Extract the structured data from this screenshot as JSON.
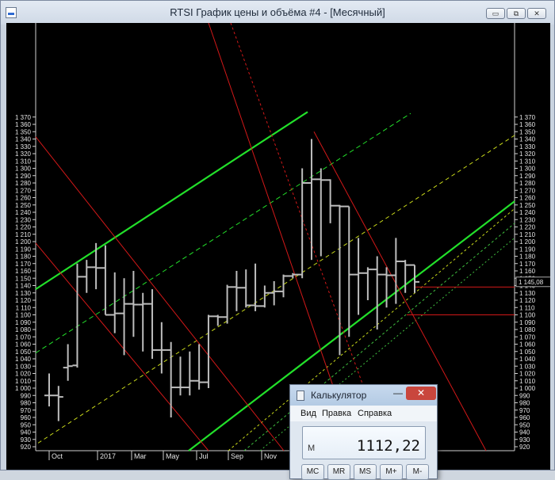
{
  "window": {
    "title": "RTSI График цены и объёма #4 - [Месячный]",
    "buttons": [
      "▭",
      "⧉",
      "✕"
    ]
  },
  "chart_data": {
    "type": "ohlc",
    "ylim": [
      917,
      1377
    ],
    "ticks": [
      920,
      930,
      940,
      950,
      960,
      970,
      980,
      990,
      1000,
      1010,
      1020,
      1030,
      1040,
      1050,
      1060,
      1070,
      1080,
      1090,
      1100,
      1110,
      1120,
      1130,
      1140,
      1150,
      1160,
      1170,
      1180,
      1190,
      1200,
      1210,
      1220,
      1230,
      1240,
      1250,
      1260,
      1270,
      1280,
      1290,
      1300,
      1310,
      1320,
      1330,
      1340,
      1350,
      1360,
      1370
    ],
    "tick_labels": [
      "920",
      "930",
      "940",
      "950",
      "960",
      "970",
      "980",
      "990",
      "1 000",
      "1 010",
      "1 020",
      "1 030",
      "1 040",
      "1 050",
      "1 060",
      "1 070",
      "1 080",
      "1 090",
      "1 100",
      "1 110",
      "1 120",
      "1 130",
      "1 140",
      "1 150",
      "1 160",
      "1 170",
      "1 180",
      "1 190",
      "1 200",
      "1 210",
      "1 220",
      "1 230",
      "1 240",
      "1 250",
      "1 260",
      "1 270",
      "1 280",
      "1 290",
      "1 300",
      "1 310",
      "1 320",
      "1 330",
      "1 340",
      "1 350",
      "1 360",
      "1 370"
    ],
    "x_labels": [
      "Oct",
      "2017",
      "Mar",
      "May",
      "Jul",
      "Sep",
      "Nov"
    ],
    "last_price_label": "1 145,08",
    "last_price": 1145.08,
    "bars": [
      {
        "o": 990,
        "h": 1020,
        "l": 975,
        "c": 990
      },
      {
        "o": 990,
        "h": 1003,
        "l": 955,
        "c": 988
      },
      {
        "o": 1028,
        "h": 1060,
        "l": 1010,
        "c": 1030
      },
      {
        "o": 1031,
        "h": 1170,
        "l": 1028,
        "c": 1152
      },
      {
        "o": 1152,
        "h": 1175,
        "l": 1130,
        "c": 1165
      },
      {
        "o": 1165,
        "h": 1198,
        "l": 1135,
        "c": 1164
      },
      {
        "o": 1164,
        "h": 1195,
        "l": 1100,
        "c": 1100
      },
      {
        "o": 1100,
        "h": 1158,
        "l": 1075,
        "c": 1102
      },
      {
        "o": 1102,
        "h": 1150,
        "l": 1045,
        "c": 1115
      },
      {
        "o": 1115,
        "h": 1160,
        "l": 1070,
        "c": 1114
      },
      {
        "o": 1114,
        "h": 1130,
        "l": 1050,
        "c": 1115
      },
      {
        "o": 1115,
        "h": 1135,
        "l": 1040,
        "c": 1052
      },
      {
        "o": 1052,
        "h": 1090,
        "l": 1020,
        "c": 1052
      },
      {
        "o": 1052,
        "h": 1063,
        "l": 960,
        "c": 1001
      },
      {
        "o": 1001,
        "h": 1043,
        "l": 990,
        "c": 1001
      },
      {
        "o": 1001,
        "h": 1050,
        "l": 990,
        "c": 1010
      },
      {
        "o": 1010,
        "h": 1060,
        "l": 998,
        "c": 1008
      },
      {
        "o": 1008,
        "h": 1100,
        "l": 1000,
        "c": 1098
      },
      {
        "o": 1098,
        "h": 1100,
        "l": 1085,
        "c": 1097
      },
      {
        "o": 1097,
        "h": 1141,
        "l": 1088,
        "c": 1138
      },
      {
        "o": 1138,
        "h": 1160,
        "l": 1105,
        "c": 1137
      },
      {
        "o": 1137,
        "h": 1162,
        "l": 1110,
        "c": 1113
      },
      {
        "o": 1113,
        "h": 1170,
        "l": 1105,
        "c": 1112
      },
      {
        "o": 1112,
        "h": 1140,
        "l": 1110,
        "c": 1130
      },
      {
        "o": 1130,
        "h": 1146,
        "l": 1113,
        "c": 1132
      },
      {
        "o": 1132,
        "h": 1155,
        "l": 1124,
        "c": 1153
      },
      {
        "o": 1153,
        "h": 1157,
        "l": 1150,
        "c": 1155
      },
      {
        "o": 1155,
        "h": 1300,
        "l": 1150,
        "c": 1280
      },
      {
        "o": 1280,
        "h": 1340,
        "l": 1175,
        "c": 1285
      },
      {
        "o": 1285,
        "h": 1300,
        "l": 1180,
        "c": 1284
      },
      {
        "o": 1284,
        "h": 1285,
        "l": 1225,
        "c": 1249
      },
      {
        "o": 1249,
        "h": 1250,
        "l": 1045,
        "c": 1248
      },
      {
        "o": 1248,
        "h": 1200,
        "l": 1070,
        "c": 1155
      },
      {
        "o": 1155,
        "h": 1205,
        "l": 1100,
        "c": 1157
      },
      {
        "o": 1157,
        "h": 1165,
        "l": 1120,
        "c": 1162
      },
      {
        "o": 1162,
        "h": 1180,
        "l": 1080,
        "c": 1155
      },
      {
        "o": 1155,
        "h": 1165,
        "l": 1110,
        "c": 1154
      },
      {
        "o": 1154,
        "h": 1205,
        "l": 1115,
        "c": 1173
      },
      {
        "o": 1173,
        "h": 1175,
        "l": 1130,
        "c": 1168
      },
      {
        "o": 1168,
        "h": 1158,
        "l": 1130,
        "c": 1145
      }
    ]
  },
  "calculator": {
    "title": "Калькулятор",
    "min_label": "—",
    "close_label": "✕",
    "menu": [
      "Вид",
      "Правка",
      "Справка"
    ],
    "memory_indicator": "M",
    "display": "1112,22",
    "buttons": [
      "MC",
      "MR",
      "MS",
      "M+",
      "M-"
    ]
  }
}
